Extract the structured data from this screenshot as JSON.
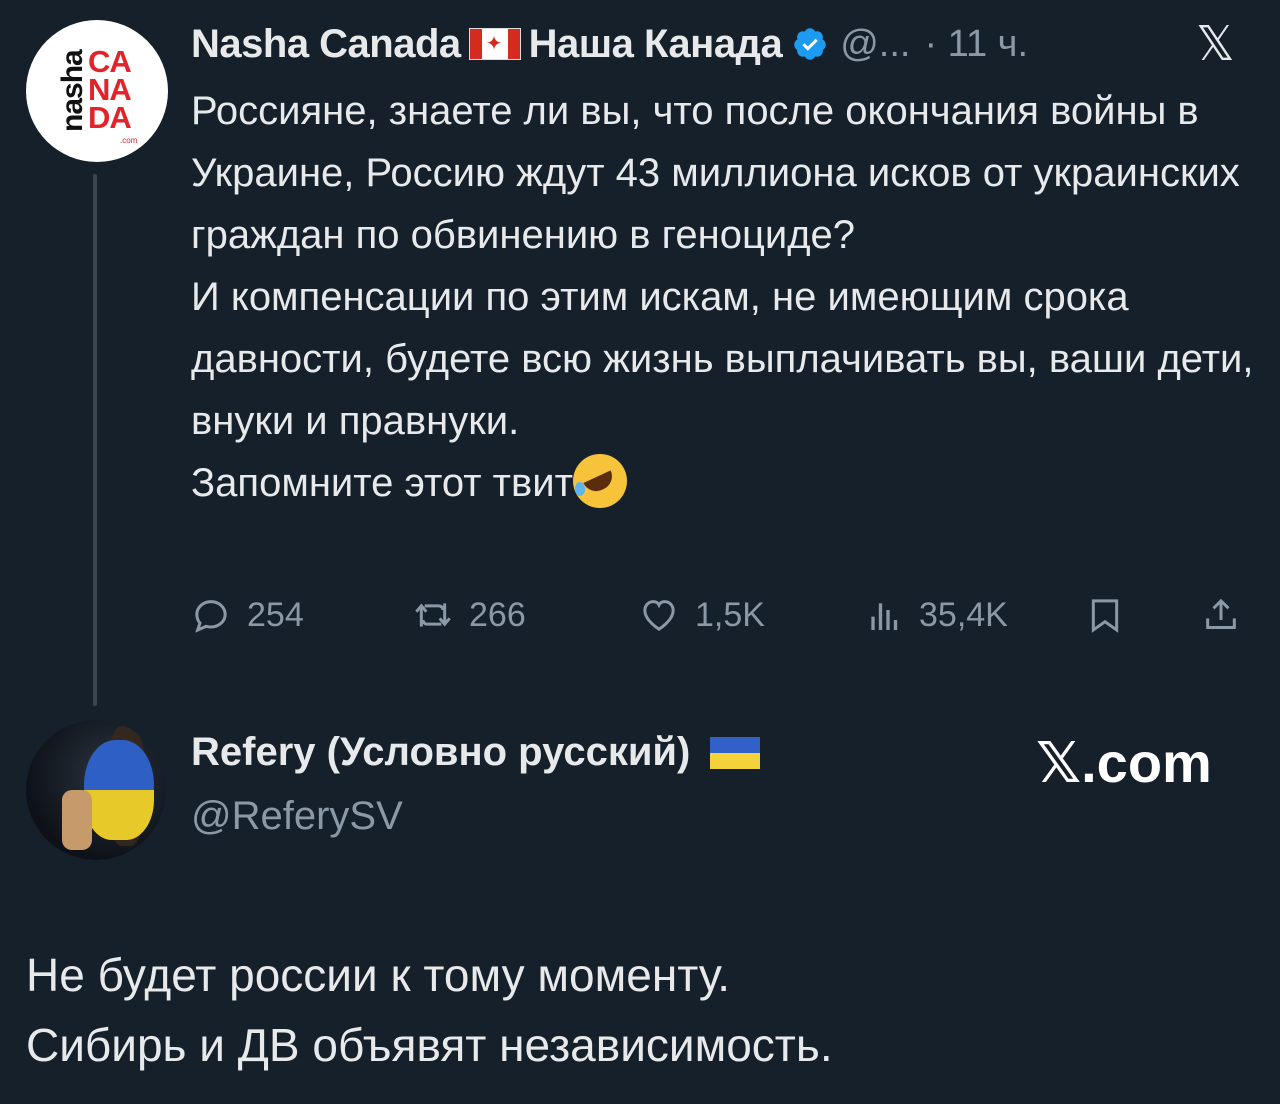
{
  "tweet": {
    "author_name": "Nasha Canada",
    "author_name_ru": "Наша Канада",
    "handle": "@...",
    "time": "· 11 ч.",
    "avatar": {
      "vertical_text": "nasha",
      "brand_lines": [
        "CA",
        "NA",
        "DA"
      ],
      "dotcom": ".com"
    },
    "paragraphs": [
      "Россияне, знаете ли вы, что после окончания войны в Украине, Россию ждут 43 миллиона исков от украинских граждан по обвинению в геноциде?",
      "И компенсации по этим искам, не имеющим срока давности, будете всю жизнь выплачивать вы, ваши дети, внуки и правнуки.",
      "Запомните этот твит"
    ],
    "emoji": "rolling-on-floor-laughing",
    "stats": {
      "replies": "254",
      "retweets": "266",
      "likes": "1,5K",
      "views": "35,4K"
    },
    "brand_icon": "x-logo-icon"
  },
  "reply": {
    "author_name": "Refery (Условно русский)",
    "handle": "@ReferySV",
    "watermark": "𝕏.com",
    "lines": [
      "Не будет россии к тому моменту.",
      "Сибирь и ДВ объявят независимость."
    ]
  },
  "colors": {
    "background": "#15202b",
    "text": "#e7e9ea",
    "muted": "#8b98a5",
    "verified": "#1d9bf0",
    "canada_red": "#d52b1e",
    "ukraine_blue": "#3160c9",
    "ukraine_yellow": "#f4d23b"
  }
}
